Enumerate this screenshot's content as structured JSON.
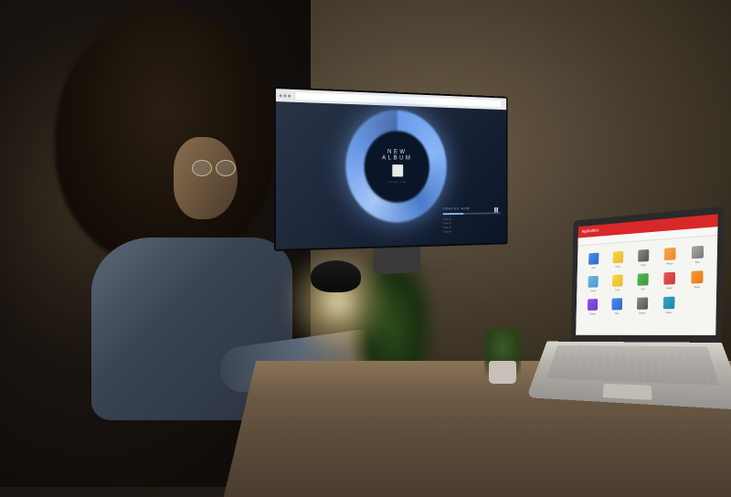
{
  "scene": {
    "description": "Woman with curly hair and glasses working at night desk with dual screens",
    "lighting": "warm desk lamp, dim ambient"
  },
  "monitor": {
    "app": "music-streaming-site",
    "album": {
      "title": "NEW ALBUM",
      "subtitle": "listen now"
    },
    "player": {
      "now_playing_label": "TRACKS NOW",
      "pause_icon": "pause-icon",
      "tracks": [
        "Track 01",
        "Track 02",
        "Track 03",
        "Track 04"
      ]
    }
  },
  "laptop": {
    "header_title": "Applications",
    "icons": [
      {
        "label": "Mail"
      },
      {
        "label": "Notes"
      },
      {
        "label": "Tools"
      },
      {
        "label": "Photos"
      },
      {
        "label": "Files"
      },
      {
        "label": "Cloud"
      },
      {
        "label": "Docs"
      },
      {
        "label": "Chat"
      },
      {
        "label": "Media"
      },
      {
        "label": "Music"
      },
      {
        "label": "Design"
      },
      {
        "label": "Web"
      },
      {
        "label": "System"
      },
      {
        "label": "Share"
      }
    ]
  }
}
